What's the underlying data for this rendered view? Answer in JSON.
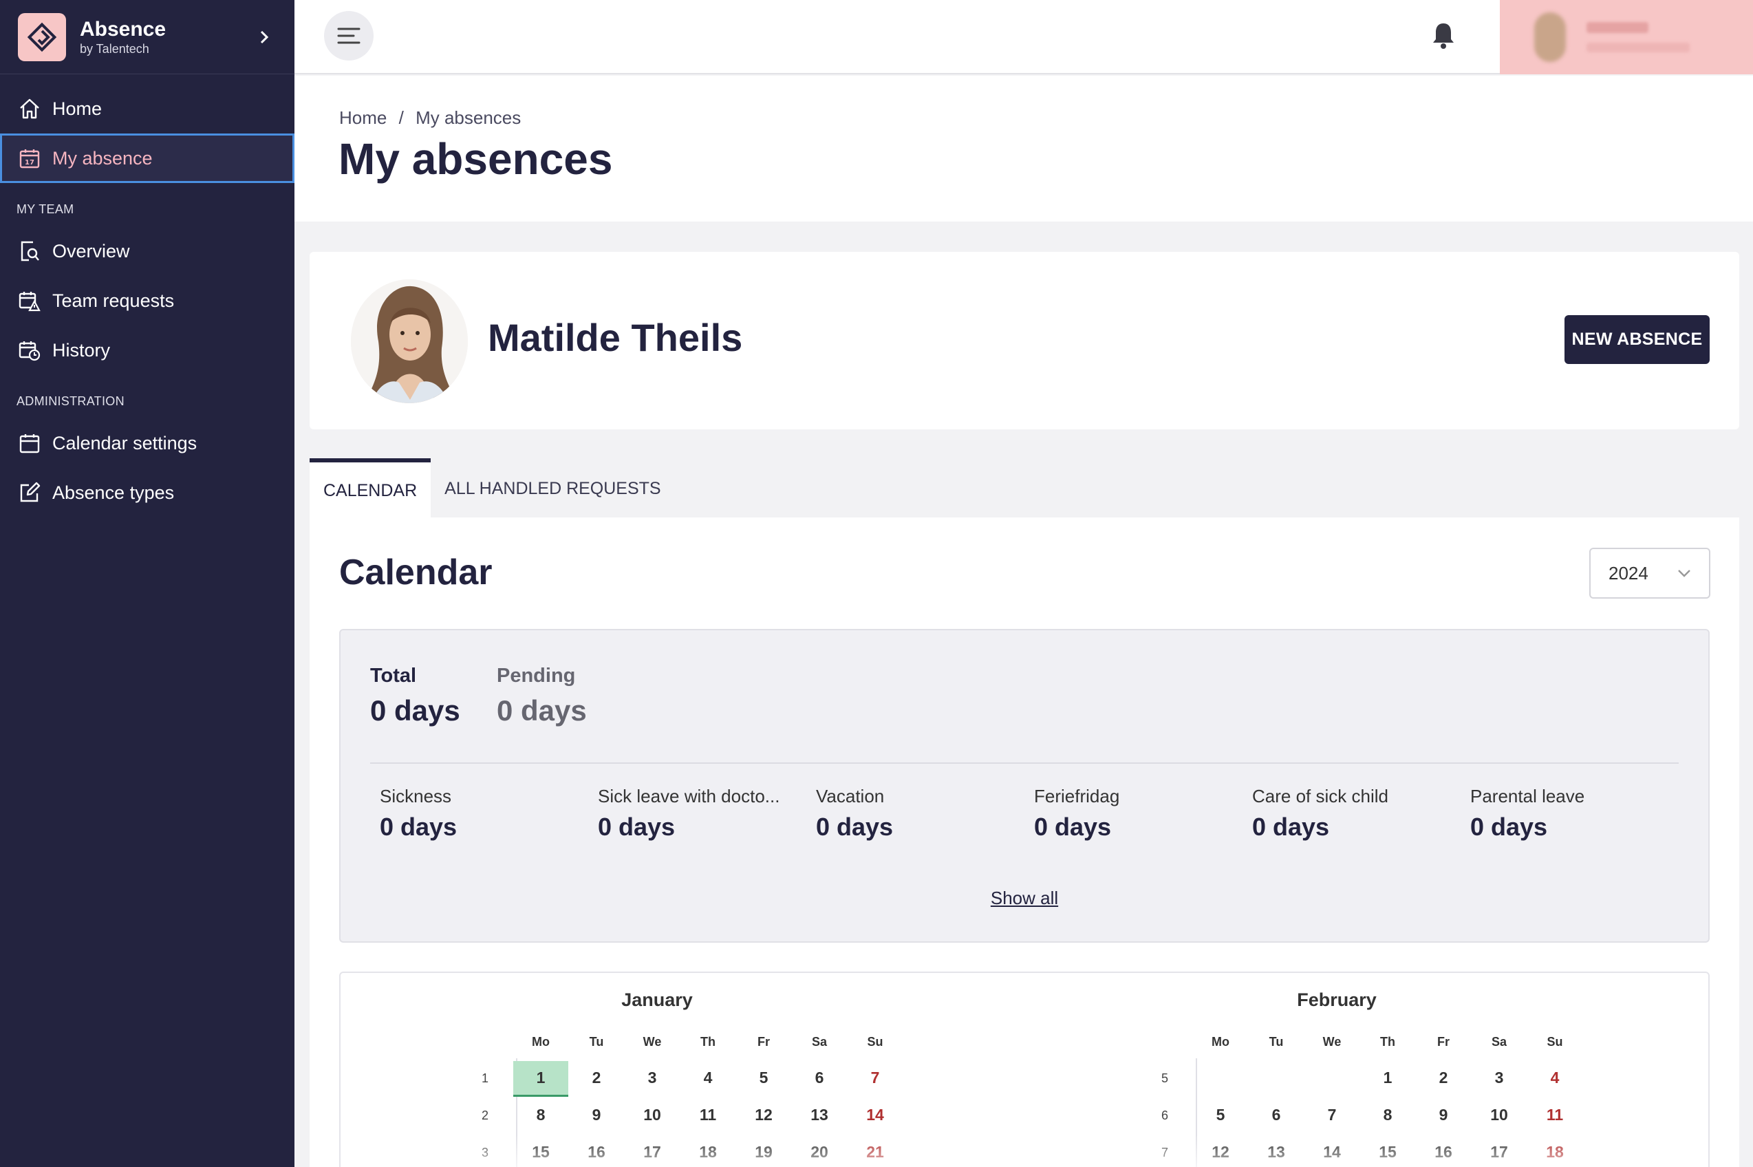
{
  "brand": {
    "title": "Absence",
    "subtitle": "by Talentech"
  },
  "nav": {
    "home": "Home",
    "my_absence": "My absence",
    "section_team": "MY TEAM",
    "overview": "Overview",
    "team_requests": "Team requests",
    "history": "History",
    "section_admin": "ADMINISTRATION",
    "calendar_settings": "Calendar settings",
    "absence_types": "Absence types"
  },
  "breadcrumb": {
    "home": "Home",
    "separator": "/",
    "current": "My absences"
  },
  "page_title": "My absences",
  "profile": {
    "name": "Matilde Theils",
    "new_absence": "NEW ABSENCE"
  },
  "tabs": {
    "calendar": "CALENDAR",
    "handled": "ALL HANDLED REQUESTS"
  },
  "calendar": {
    "title": "Calendar",
    "year": "2024",
    "total_label": "Total",
    "total_value": "0 days",
    "pending_label": "Pending",
    "pending_value": "0 days",
    "types": [
      {
        "label": "Sickness",
        "value": "0 days"
      },
      {
        "label": "Sick leave with docto...",
        "value": "0 days"
      },
      {
        "label": "Vacation",
        "value": "0 days"
      },
      {
        "label": "Feriefridag",
        "value": "0 days"
      },
      {
        "label": "Care of sick child",
        "value": "0 days"
      },
      {
        "label": "Parental leave",
        "value": "0 days"
      }
    ],
    "show_all": "Show all",
    "weekdays": [
      "Mo",
      "Tu",
      "We",
      "Th",
      "Fr",
      "Sa",
      "Su"
    ],
    "months": [
      {
        "name": "January",
        "rows": [
          {
            "week": "1",
            "days": [
              "1",
              "2",
              "3",
              "4",
              "5",
              "6",
              "7"
            ]
          },
          {
            "week": "2",
            "days": [
              "8",
              "9",
              "10",
              "11",
              "12",
              "13",
              "14"
            ]
          },
          {
            "week": "3",
            "days": [
              "15",
              "16",
              "17",
              "18",
              "19",
              "20",
              "21"
            ]
          }
        ]
      },
      {
        "name": "February",
        "rows": [
          {
            "week": "5",
            "days": [
              "",
              "",
              "",
              "1",
              "2",
              "3",
              "4"
            ]
          },
          {
            "week": "6",
            "days": [
              "5",
              "6",
              "7",
              "8",
              "9",
              "10",
              "11"
            ]
          },
          {
            "week": "7",
            "days": [
              "12",
              "13",
              "14",
              "15",
              "16",
              "17",
              "18"
            ]
          }
        ]
      }
    ],
    "today": "1"
  },
  "colors": {
    "sidebar": "#23233f",
    "accent_pink": "#f7c6c6",
    "active_text": "#f6b5c0",
    "today": "#b7e3c8",
    "sunday": "#b03030"
  }
}
